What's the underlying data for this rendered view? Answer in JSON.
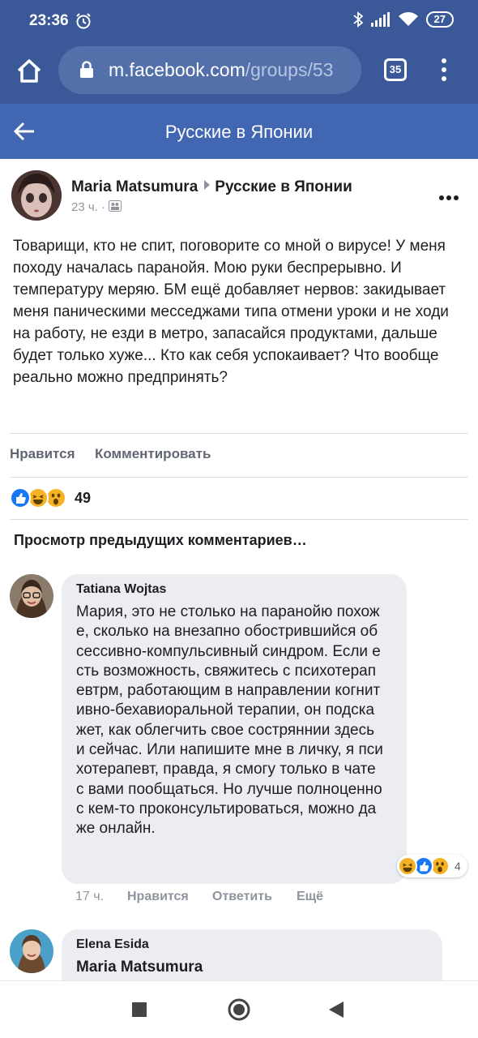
{
  "status_bar": {
    "time": "23:36",
    "battery": "27"
  },
  "browser": {
    "url_host": "m.facebook.com",
    "url_path": "/groups/53",
    "tab_count": "35"
  },
  "header": {
    "title": "Русские в Японии"
  },
  "post": {
    "author": "Maria Matsumura",
    "group": "Русские в Японии",
    "time": "23 ч. ·",
    "text": "Товарищи, кто не спит, поговорите со мной о вирусе! У меня походу началась паранойя. Мою руки беспрерывно. И температуру меряю. БМ ещё добавляет нервов: закидывает меня паническими месседжами типа отмени уроки и не ходи на работу, не езди в метро, запасайся продуктами, дальше будет только хуже... Кто как себя успокаивает? Что вообще реально можно предпринять?",
    "like_label": "Нравится",
    "comment_label": "Комментировать",
    "reaction_count": "49",
    "view_previous": "Просмотр предыдущих комментариев…"
  },
  "comments": [
    {
      "author": "Tatiana Wojtas",
      "text": "Мария, это не столько на паранойю похоже, сколько на внезапно обострившийся обсессивно-компульсивный синдром. Если есть возможность, свяжитесь с психотерапевтрм, работающим в направлении когнитивно-бехавиоральной терапии, он подскажет, как облегчить свое состряннии здесь и сейчас. Или напишите мне в личку, я психотерапевт, правда, я смогу только в чате с вами пообщаться. Но лучше полноценно с кем-то проконсультироваться, можно даже онлайн.",
      "reaction_count": "4",
      "time": "17 ч.",
      "like_label": "Нравится",
      "reply_label": "Ответить",
      "more_label": "Ещё"
    },
    {
      "author": "Elena Esida",
      "text": "Maria Matsumura"
    }
  ],
  "colors": {
    "brand_dark": "#3b5998",
    "brand": "#4267b2",
    "like": "#1877f2",
    "emoji": "#f7b125"
  }
}
